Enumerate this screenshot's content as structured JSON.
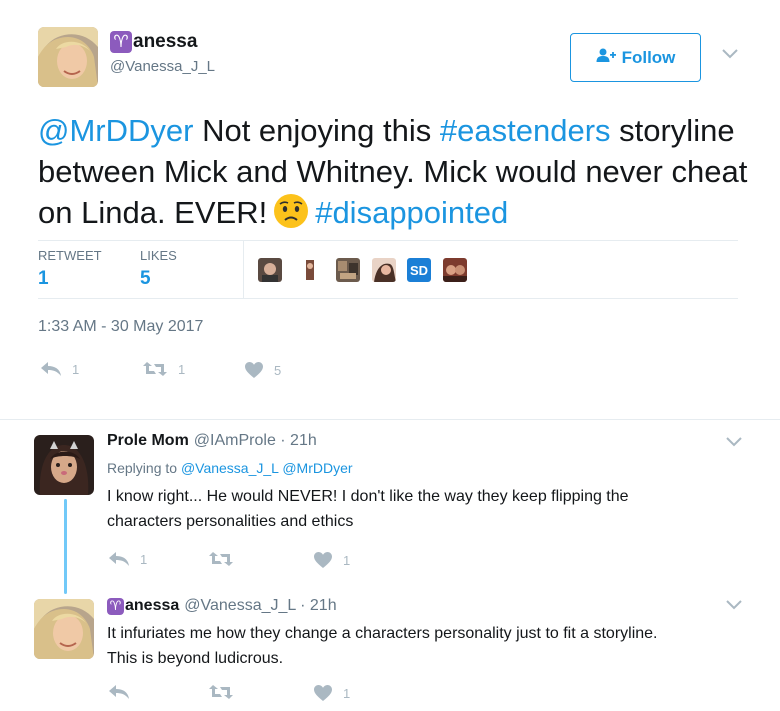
{
  "tweet": {
    "author_name_rest": "anessa",
    "aries_glyph": "♈",
    "author_handle": "@Vanessa_J_L",
    "follow_label": "Follow",
    "text": {
      "mention": "@MrDDyer",
      "part1": " Not enjoying this ",
      "hashtag1": "#eastenders",
      "part2": " storyline between Mick and Whitney. Mick would never cheat on Linda. EVER!",
      "hashtag2": "#disappointed"
    },
    "emoji": "worried-face",
    "stats": {
      "retweet_label": "RETWEET",
      "retweet_count": "1",
      "likes_label": "LIKES",
      "likes_count": "5",
      "sd_label": "SD"
    },
    "timestamp": "1:33 AM - 30 May 2017",
    "actions": {
      "reply_count": "1",
      "retweet_count": "1",
      "like_count": "5"
    }
  },
  "replies": [
    {
      "name": "Prole Mom",
      "handle_time": "@IAmProle · 21h",
      "replying_prefix": "Replying to",
      "replying_to": "@Vanessa_J_L @MrDDyer",
      "text_line1": "I know right... He would NEVER! I don't like the way they keep flipping the",
      "text_line2": "characters personalities and ethics",
      "reply_count": "1",
      "like_count": "1"
    },
    {
      "name_rest": "anessa",
      "handle_time": "@Vanessa_J_L · 21h",
      "text_line1": "It infuriates me how they change a characters personality just to fit a storyline.",
      "text_line2": "This is beyond ludicrous.",
      "like_count": "1"
    }
  ],
  "colors": {
    "link": "#1b95e0",
    "muted": "#657786",
    "icon": "#aab8c2",
    "aries_badge": "#8c5bbd",
    "thread_line": "#71c9f8"
  }
}
